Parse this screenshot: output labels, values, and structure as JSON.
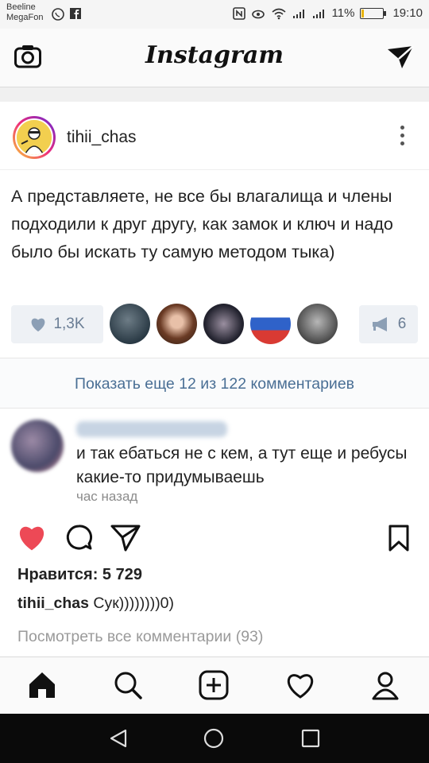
{
  "status_bar": {
    "carrier_1": "Beeline",
    "carrier_2": "MegaFon",
    "battery": "11%",
    "time": "19:10"
  },
  "app": {
    "title": "Instagram"
  },
  "post": {
    "username": "tihii_chas",
    "text": "А представляете, не все бы влагалища и члены подходили к друг другу, как замок и ключ и надо было бы искать ту самую методом тыка)",
    "likes_short": "1,3K",
    "reposts": "6"
  },
  "comments": {
    "show_more": "Показать еще 12 из 122 комментариев",
    "comment": {
      "text": "и так ебаться не с кем, а тут еще и ребусы какие-то придумываешь",
      "time": "час назад"
    }
  },
  "feed": {
    "likes_label": "Нравится: 5 729",
    "caption_user": "tihii_chas",
    "caption_text": " Сук))))))))0)",
    "view_all": "Посмотреть все комментарии (93)"
  },
  "colors": {
    "like_red": "#ed4956",
    "link_blue": "#4a6f95"
  }
}
